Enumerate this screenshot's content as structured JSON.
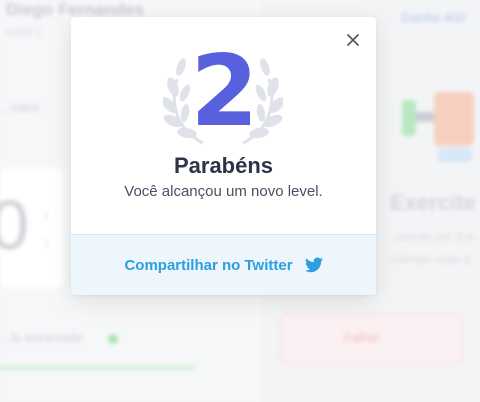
{
  "background": {
    "user_name": "Diego Fernandes",
    "user_sub": "Level 1",
    "tab_text": "...ndes",
    "top_link": "Ganhe 400",
    "timer_digit": "0",
    "colon": ":",
    "done_text": "...lo encerrado",
    "exercise_title": "Exercite",
    "exercise_desc_1": "...xercite por 3 m",
    "exercise_desc_2": "...otempo suas p",
    "fail_label": "Falhei",
    "colors": {
      "green": "#a8e6b3",
      "red": "#f1b9be",
      "blue": "#b7c4ef"
    }
  },
  "modal": {
    "level": "2",
    "title": "Parabéns",
    "subtitle": "Você alcançou um novo level.",
    "share_label": "Compartilhar no Twitter",
    "icons": {
      "close": "close-icon",
      "laurel": "laurel-icon",
      "twitter": "twitter-icon"
    },
    "colors": {
      "level": "#5960dd",
      "title": "#2a3548",
      "share": "#2b9fe0",
      "footer_bg": "#ecf6fc"
    }
  }
}
